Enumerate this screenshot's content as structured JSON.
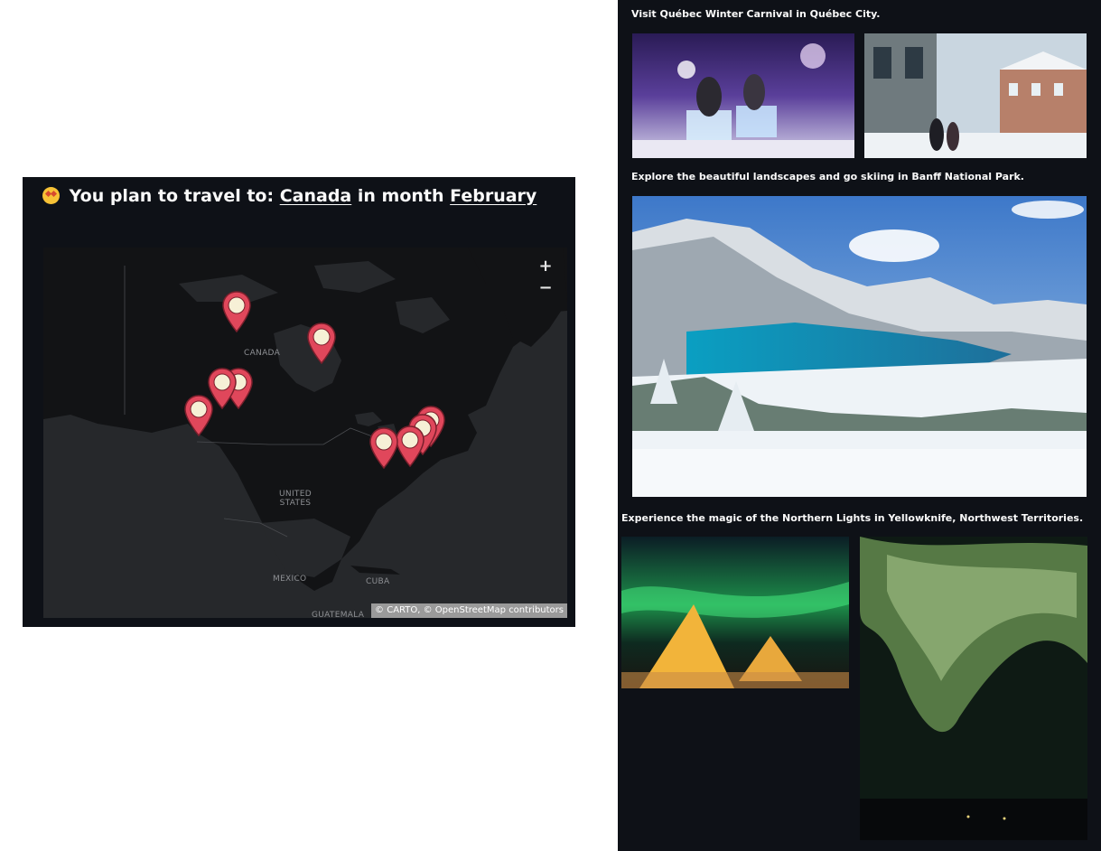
{
  "map_panel": {
    "title_prefix": "You plan to travel to:",
    "country": "Canada",
    "month_prefix": "in month",
    "month": "February",
    "zoom_in_label": "+",
    "zoom_out_label": "−",
    "map_labels": {
      "canada": "CANADA",
      "united_states_line1": "UNITED",
      "united_states_line2": "STATES",
      "mexico": "MEXICO",
      "cuba": "CUBA",
      "guatemala": "GUATEMALA"
    },
    "attribution": {
      "carto": "© CARTO,",
      "osm": "© OpenStreetMap",
      "contributors": "contributors"
    },
    "marker_color": "#e0475b",
    "marker_count": 9
  },
  "recommendations": [
    {
      "caption": "Visit Québec Winter Carnival in Québec City.",
      "images": [
        "carnival-ice-slide-photo",
        "old-quebec-snowy-street-photo"
      ]
    },
    {
      "caption": "Explore the beautiful landscapes and go skiing in Banff National Park.",
      "images": [
        "banff-peyto-lake-photo"
      ]
    },
    {
      "caption": "Experience the magic of the Northern Lights in Yellowknife, Northwest Territories.",
      "images": [
        "aurora-teepees-photo",
        "aurora-sky-photo"
      ]
    }
  ],
  "colors": {
    "panel_bg": "#0e1117",
    "map_bg": "#26282b",
    "land": "#121315",
    "text": "#fafafa"
  }
}
